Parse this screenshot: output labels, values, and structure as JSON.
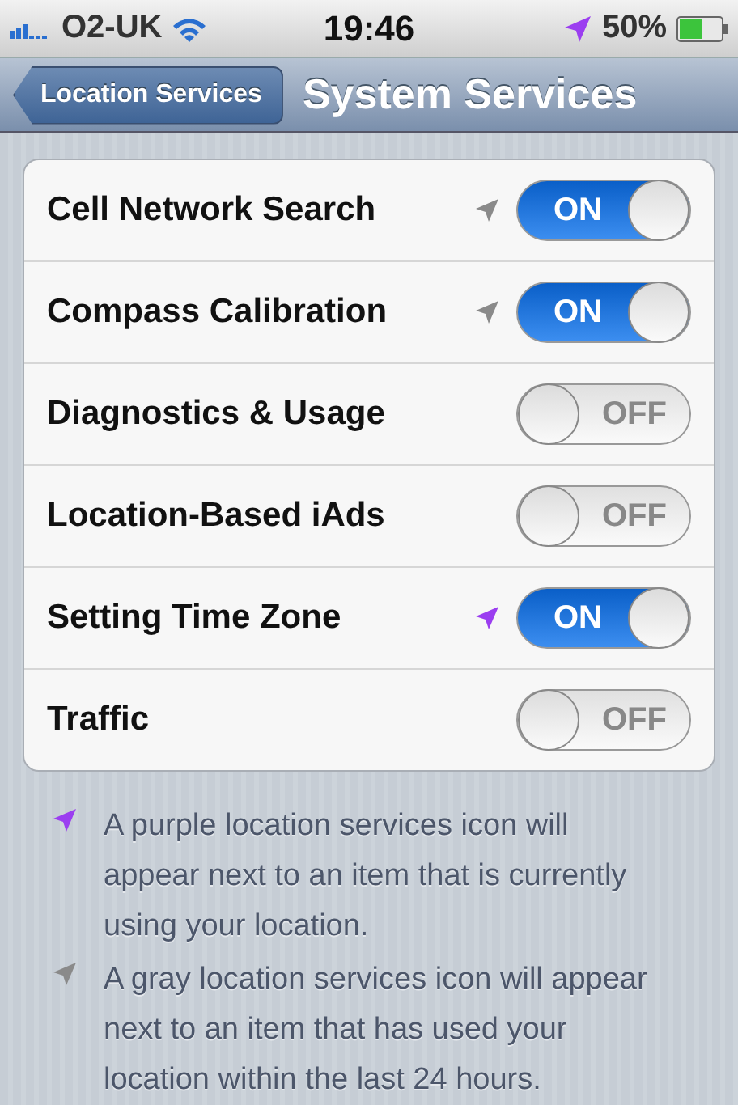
{
  "status_bar": {
    "carrier": "O2-UK",
    "time": "19:46",
    "battery": "50%"
  },
  "nav_bar": {
    "back": "Location Services",
    "title": "System Services"
  },
  "rows": [
    {
      "label": "Cell Network Search",
      "on": true,
      "switch_text": "ON",
      "color": "#8a8a8a"
    },
    {
      "label": "Compass Calibration",
      "on": true,
      "switch_text": "ON",
      "color": "#8a8a8a"
    },
    {
      "label": "Diagnostics & Usage",
      "on": false,
      "switch_text": "OFF"
    },
    {
      "label": "Location-Based iAds",
      "on": false,
      "switch_text": "OFF"
    },
    {
      "label": "Setting Time Zone",
      "on": true,
      "switch_text": "ON",
      "color": "#9b3ef0"
    },
    {
      "label": "Traffic",
      "on": false,
      "switch_text": "OFF"
    }
  ],
  "notes": [
    {
      "text": "A purple location services icon will appear next to an item that is currently using your location.",
      "color": "#9b3ef0"
    },
    {
      "text": "A gray location services icon will appear next to an item that has used your location within the last 24 hours.",
      "color": "#8a8a8a"
    }
  ]
}
